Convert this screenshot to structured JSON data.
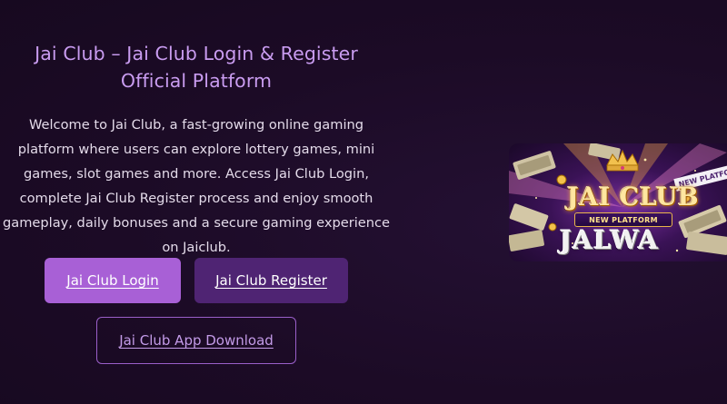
{
  "hero": {
    "title": "Jai Club – Jai Club Login & Register Official Platform",
    "description": "Welcome to Jai Club, a fast-growing online gaming platform where users can explore lottery games, mini games, slot games and more. Access Jai Club Login, complete Jai Club Register process and enjoy smooth gameplay, daily bonuses and a secure gaming experience on Jaiclub."
  },
  "buttons": {
    "login_label": "Jai Club Login",
    "register_label": "Jai Club Register",
    "download_label": "Jai Club App Download"
  },
  "banner": {
    "brand": "JAI CLUB",
    "sub": "NEW PLATFORM",
    "word": "JALWA",
    "ribbon": "NEW PLATFORM"
  },
  "colors": {
    "background": "#1c0b26",
    "title": "#c99cf0",
    "login_button": "#a860d6",
    "register_button": "#4f2473",
    "download_border": "#9a5fc9"
  }
}
